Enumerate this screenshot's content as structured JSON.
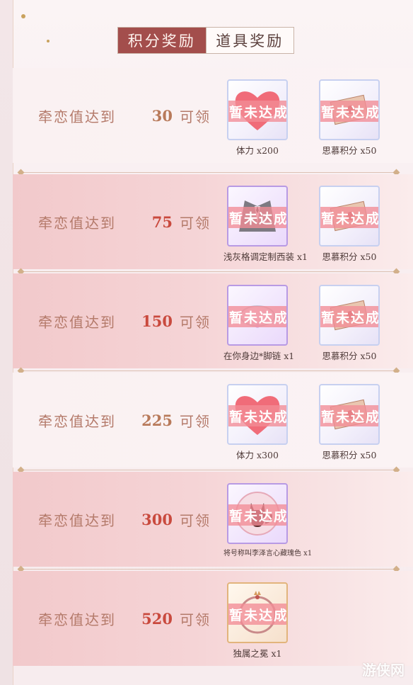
{
  "tabs": [
    {
      "label": "积分奖励",
      "active": true
    },
    {
      "label": "道具奖励",
      "active": false
    }
  ],
  "rows": [
    {
      "label": "牵恋值达到",
      "value": "30",
      "suffix": "可领",
      "items": [
        {
          "name": "体力 x200",
          "icon": "heart-icon",
          "stamp": "暂未达成"
        },
        {
          "name": "思慕积分 x50",
          "icon": "letter-icon",
          "stamp": "暂未达成"
        }
      ]
    },
    {
      "label": "牵恋值达到",
      "value": "75",
      "suffix": "可领",
      "items": [
        {
          "name": "浅灰格调定制西装 x1",
          "icon": "suit-icon",
          "stamp": "暂未达成"
        },
        {
          "name": "思慕积分 x50",
          "icon": "letter-icon",
          "stamp": "暂未达成"
        }
      ]
    },
    {
      "label": "牵恋值达到",
      "value": "150",
      "suffix": "可领",
      "items": [
        {
          "name": "在你身边*脚链 x1",
          "icon": "anklet-icon",
          "stamp": "暂未达成"
        },
        {
          "name": "思慕积分 x50",
          "icon": "letter-icon",
          "stamp": "暂未达成"
        }
      ]
    },
    {
      "label": "牵恋值达到",
      "value": "225",
      "suffix": "可领",
      "items": [
        {
          "name": "体力 x300",
          "icon": "heart-icon",
          "stamp": "暂未达成"
        },
        {
          "name": "思慕积分 x50",
          "icon": "letter-icon",
          "stamp": "暂未达成"
        }
      ]
    },
    {
      "label": "牵恋值达到",
      "value": "300",
      "suffix": "可领",
      "items": [
        {
          "name": "将号称叫李泽言心藏瑰色 x1",
          "icon": "cat-avatar-icon",
          "stamp": "暂未达成"
        }
      ]
    },
    {
      "label": "牵恋值达到",
      "value": "520",
      "suffix": "可领",
      "items": [
        {
          "name": "独属之冕 x1",
          "icon": "crown-ring-icon",
          "stamp": "暂未达成"
        }
      ]
    }
  ],
  "watermark": "游侠网",
  "colors": {
    "accent": "#a34e4c",
    "value": "#c94a3e",
    "stamp": "#f28c96"
  }
}
